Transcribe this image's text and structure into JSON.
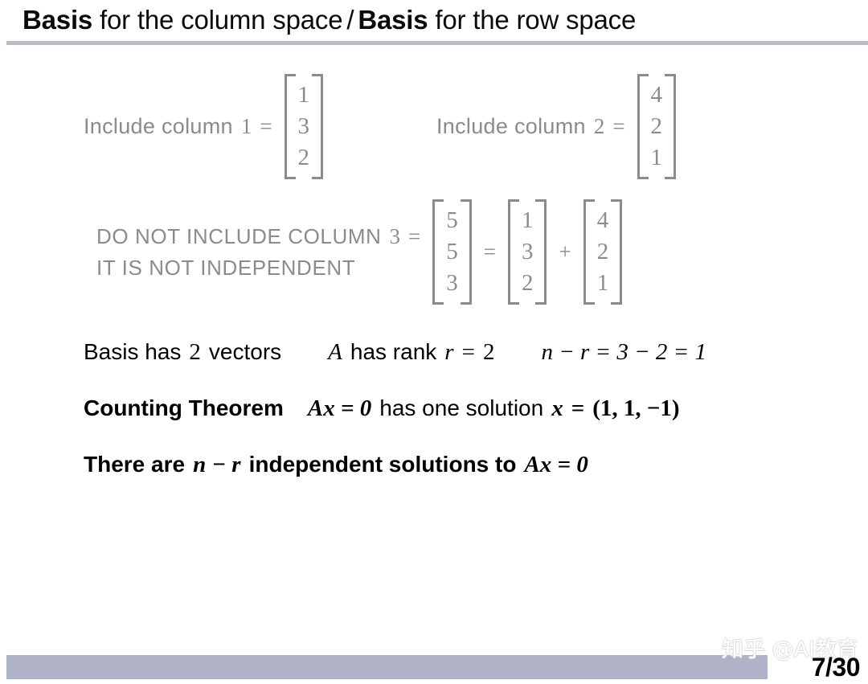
{
  "slide": {
    "title": {
      "part1_bold": "Basis",
      "part1_rest": " for the column space",
      "separator": "/",
      "part2_bold": "Basis",
      "part2_rest": " for the row space"
    },
    "rule_color": "#b9b9c9",
    "gray_color": "#8b8b8b",
    "footer_bar_color": "#b0b2c8"
  },
  "columns": [
    {
      "label": "Include column",
      "index": "1",
      "equals": "=",
      "vector": [
        "1",
        "3",
        "2"
      ]
    },
    {
      "label": "Include column",
      "index": "2",
      "equals": "=",
      "vector": [
        "4",
        "2",
        "1"
      ]
    }
  ],
  "excluded": {
    "line1": "DO NOT INCLUDE COLUMN",
    "index": "3",
    "line2": "IT IS NOT INDEPENDENT",
    "equals1": "=",
    "result_vector": [
      "5",
      "5",
      "3"
    ],
    "equals2": "=",
    "term1_vector": [
      "1",
      "3",
      "2"
    ],
    "plus": "+",
    "term2_vector": [
      "4",
      "2",
      "1"
    ]
  },
  "facts": {
    "basis_text": "Basis has",
    "basis_count": "2",
    "basis_tail": "vectors",
    "rank_matrix": "A",
    "rank_text": "has rank",
    "rank_var": "r",
    "rank_eq": "=",
    "rank_value": "2",
    "nullity_expr": "n − r = 3 − 2 = 1"
  },
  "counting_theorem": {
    "heading": "Counting Theorem",
    "equation": "Ax = 0",
    "middle": "has one solution",
    "solution_var": "x",
    "solution_eq": "=",
    "solution_value": "(1, 1, −1)"
  },
  "conclusion": {
    "prefix": "There are",
    "expr": "n − r",
    "middle": "independent solutions to",
    "equation": "Ax = 0"
  },
  "footer": {
    "watermark": "知乎 @AI教育",
    "page_number": "7/30"
  }
}
